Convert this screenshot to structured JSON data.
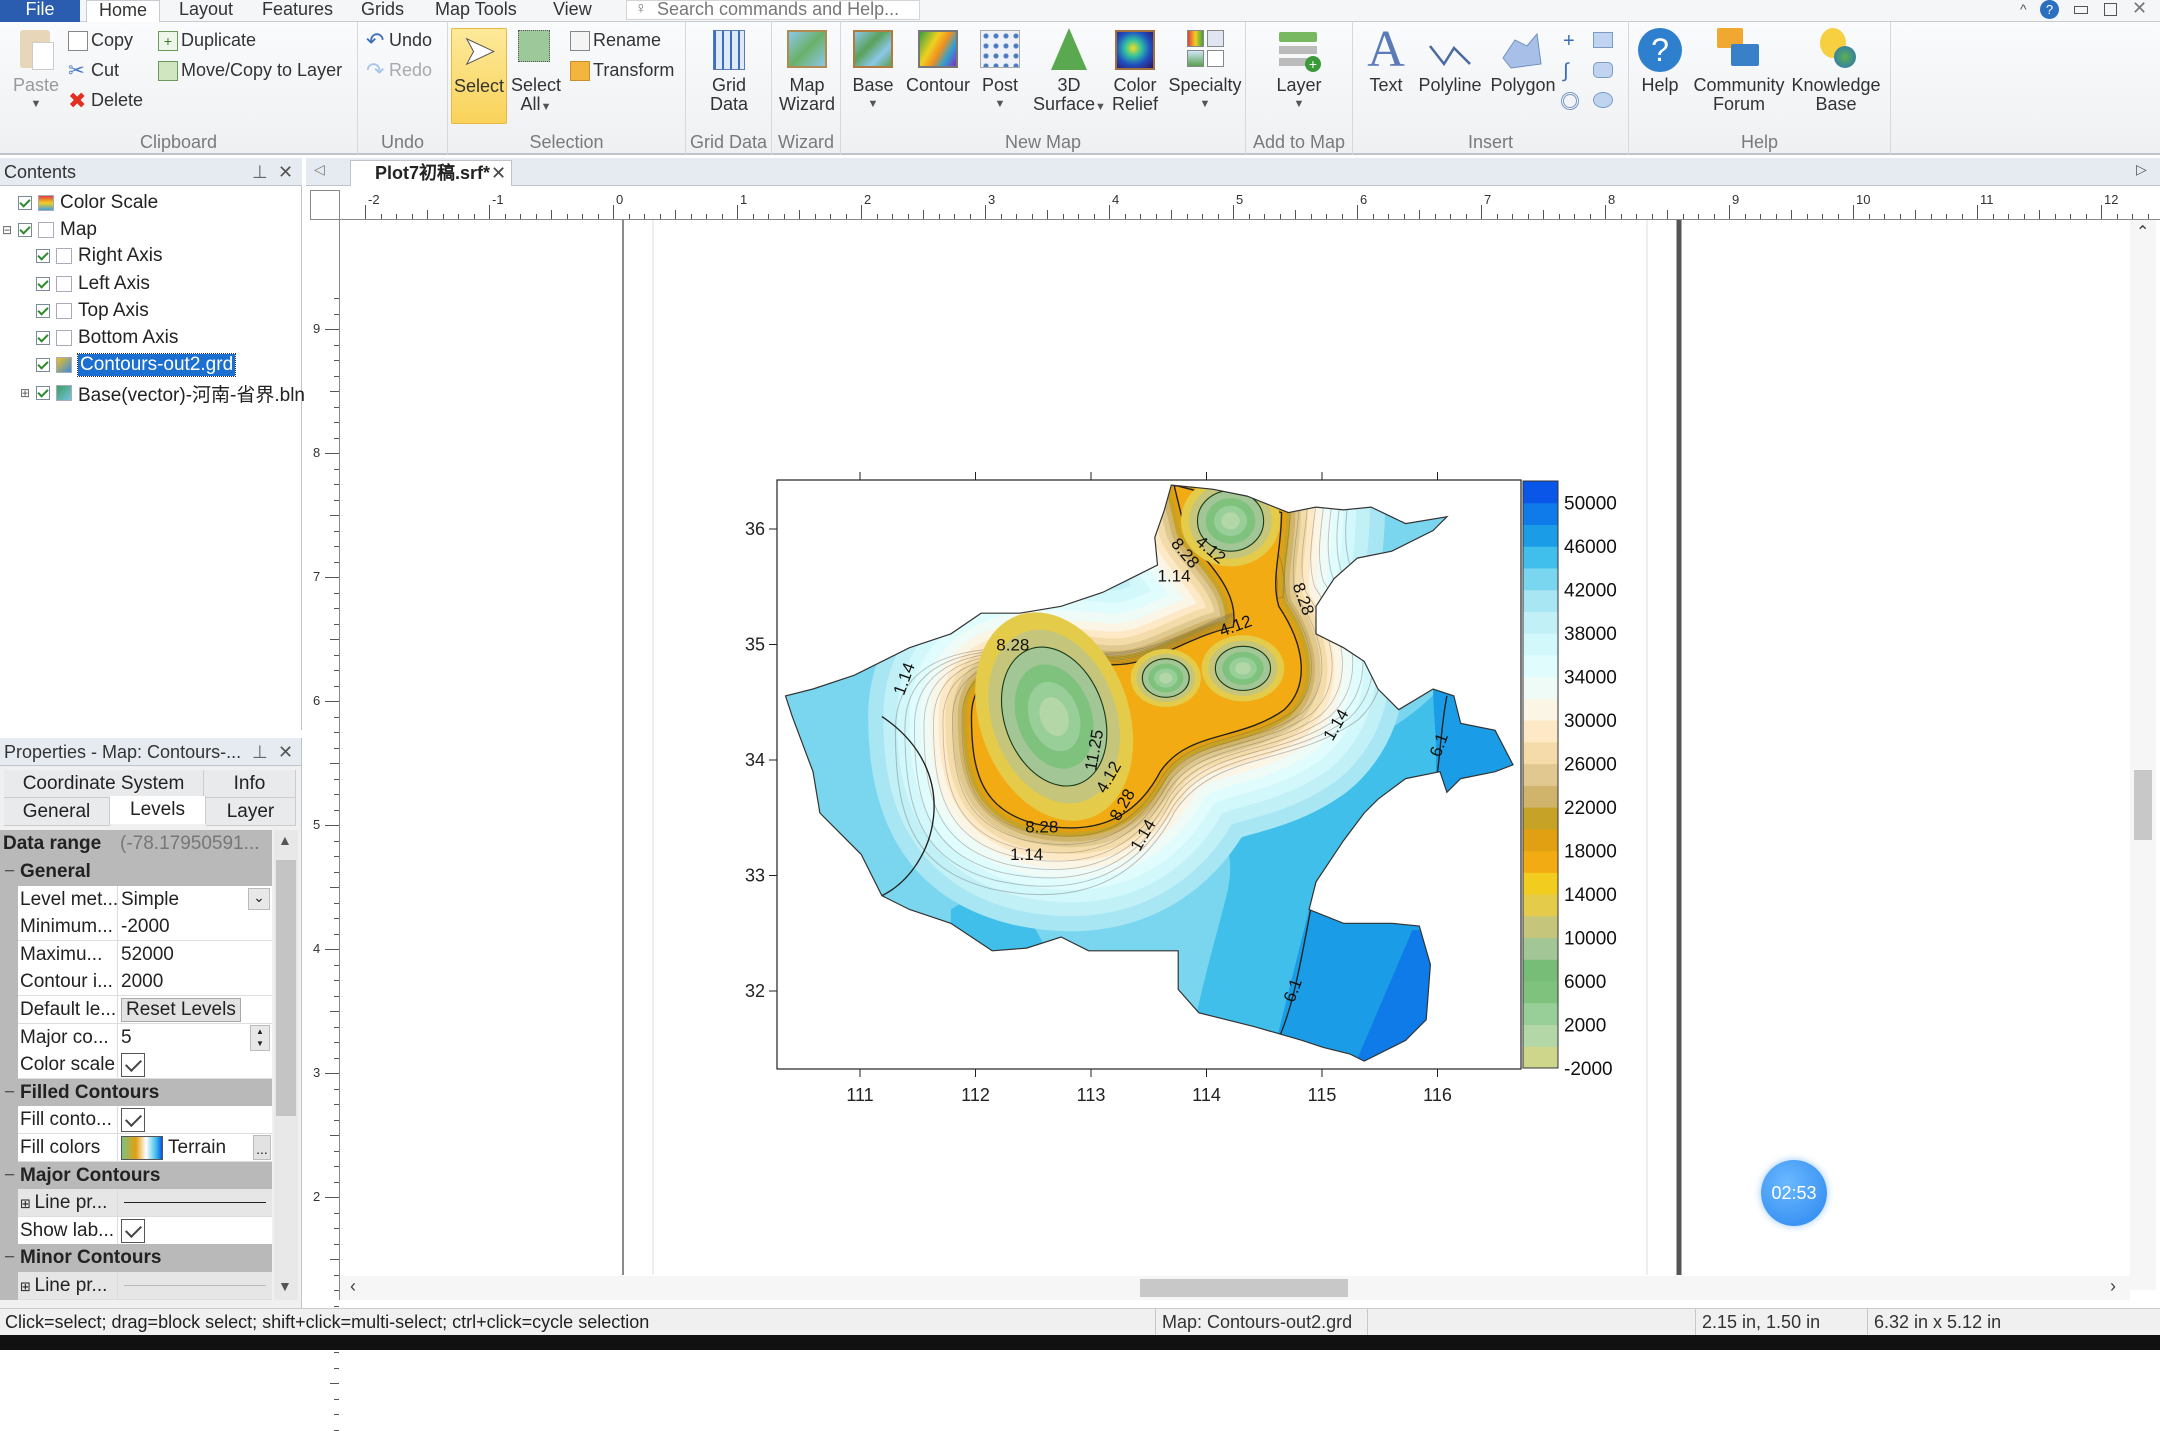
{
  "menu": {
    "file": "File",
    "tabs": [
      "Home",
      "Layout",
      "Features",
      "Grids",
      "Map Tools",
      "View"
    ],
    "search_placeholder": "Search commands and Help..."
  },
  "ribbon": {
    "clipboard": {
      "paste": "Paste",
      "copy": "Copy",
      "cut": "Cut",
      "delete": "Delete",
      "duplicate": "Duplicate",
      "move_copy": "Move/Copy to Layer",
      "label": "Clipboard"
    },
    "undo": {
      "undo": "Undo",
      "redo": "Redo",
      "label": "Undo"
    },
    "selection": {
      "select": "Select",
      "select_all_1": "Select",
      "select_all_2": "All",
      "rename": "Rename",
      "transform": "Transform",
      "label": "Selection"
    },
    "grid_data": {
      "btn_1": "Grid",
      "btn_2": "Data",
      "label": "Grid Data"
    },
    "wizard": {
      "btn_1": "Map",
      "btn_2": "Wizard",
      "label": "Wizard"
    },
    "new_map": {
      "base": "Base",
      "contour": "Contour",
      "post": "Post",
      "surface_1": "3D",
      "surface_2": "Surface",
      "relief_1": "Color",
      "relief_2": "Relief",
      "specialty": "Specialty",
      "label": "New Map"
    },
    "add_to_map": {
      "layer": "Layer",
      "label": "Add to Map"
    },
    "insert": {
      "text": "Text",
      "polyline": "Polyline",
      "polygon": "Polygon",
      "label": "Insert"
    },
    "help": {
      "help": "Help",
      "forum_1": "Community",
      "forum_2": "Forum",
      "kb_1": "Knowledge",
      "kb_2": "Base",
      "label": "Help"
    }
  },
  "contents": {
    "title": "Contents",
    "items": [
      {
        "label": "Color Scale",
        "checked": true
      },
      {
        "label": "Map",
        "checked": true
      },
      {
        "label": "Right Axis",
        "checked": true
      },
      {
        "label": "Left Axis",
        "checked": true
      },
      {
        "label": "Top Axis",
        "checked": true
      },
      {
        "label": "Bottom Axis",
        "checked": true
      },
      {
        "label": "Contours-out2.grd",
        "checked": true,
        "selected": true
      },
      {
        "label": "Base(vector)-河南-省界.bln",
        "checked": true
      }
    ]
  },
  "properties": {
    "title": "Properties - Map: Contours-...",
    "tabs": [
      "Coordinate System",
      "Info",
      "General",
      "Levels",
      "Layer"
    ],
    "active_tab": "Levels",
    "data_range_label": "Data range",
    "data_range_value": "(-78.17950591...",
    "rows": [
      {
        "type": "cat",
        "label": "General"
      },
      {
        "label": "Level met...",
        "value": "Simple",
        "control": "dropdown"
      },
      {
        "label": "Minimum...",
        "value": "-2000"
      },
      {
        "label": "Maximu...",
        "value": "52000"
      },
      {
        "label": "Contour i...",
        "value": "2000"
      },
      {
        "label": "Default le...",
        "value": "Reset Levels",
        "control": "button"
      },
      {
        "label": "Major co...",
        "value": "5",
        "control": "spinner"
      },
      {
        "label": "Color scale",
        "control": "check"
      },
      {
        "type": "cat",
        "label": "Filled Contours"
      },
      {
        "label": "Fill conto...",
        "control": "check"
      },
      {
        "label": "Fill colors",
        "value": "Terrain",
        "control": "colormap"
      },
      {
        "type": "cat",
        "label": "Major Contours"
      },
      {
        "label": "Line pr...",
        "control": "line"
      },
      {
        "label": "Show lab...",
        "control": "check"
      },
      {
        "type": "cat",
        "label": "Minor Contours"
      },
      {
        "label": "Line pr...",
        "control": "line-light"
      }
    ]
  },
  "document": {
    "tab": "Plot7初稿.srf*",
    "ruler_top": [
      "-2",
      "-1",
      "0",
      "1",
      "2",
      "3",
      "4",
      "5",
      "6",
      "7",
      "8",
      "9",
      "10",
      "11",
      "12"
    ],
    "ruler_left": [
      "9",
      "8",
      "7",
      "6",
      "5",
      "4",
      "3",
      "2"
    ]
  },
  "map": {
    "x_ticks": [
      "111",
      "112",
      "113",
      "114",
      "115",
      "116"
    ],
    "y_ticks": [
      "36",
      "35",
      "34",
      "33",
      "32"
    ],
    "contour_labels": [
      "8.28",
      "4.12",
      "1.14",
      "8.28",
      "4.12",
      "8.28",
      "1.14",
      "11.25",
      "4.12",
      "8.28",
      "1.14",
      "8.28",
      "1.14",
      "1.14",
      "6.1",
      "6.1"
    ],
    "colorbar_labels": [
      "50000",
      "46000",
      "42000",
      "38000",
      "34000",
      "30000",
      "26000",
      "22000",
      "18000",
      "14000",
      "10000",
      "6000",
      "2000",
      "-2000"
    ],
    "colorbar_colors_bottom_to_top": [
      "#cdd68a",
      "#b3d7a6",
      "#98cf98",
      "#7ec27e",
      "#77bc77",
      "#a2c695",
      "#c6c57c",
      "#e4cc4a",
      "#f2cc1e",
      "#f2ab12",
      "#e0a012",
      "#c6a226",
      "#d0b46c",
      "#e0c990",
      "#f4dcaa",
      "#fde9c6",
      "#fbf5e6",
      "#effbf7",
      "#e0fcfc",
      "#d2f8fb",
      "#c2f0f7",
      "#a8e6f3",
      "#7ad6ef",
      "#40bfeb",
      "#1a9de6",
      "#0f7be8",
      "#0a56e8"
    ]
  },
  "timer": "02:53",
  "status": {
    "hint": "Click=select; drag=block select; shift+click=multi-select; ctrl+click=cycle selection",
    "object": "Map: Contours-out2.grd",
    "position": "2.15 in, 1.50 in",
    "size": "6.32 in x 5.12 in"
  }
}
